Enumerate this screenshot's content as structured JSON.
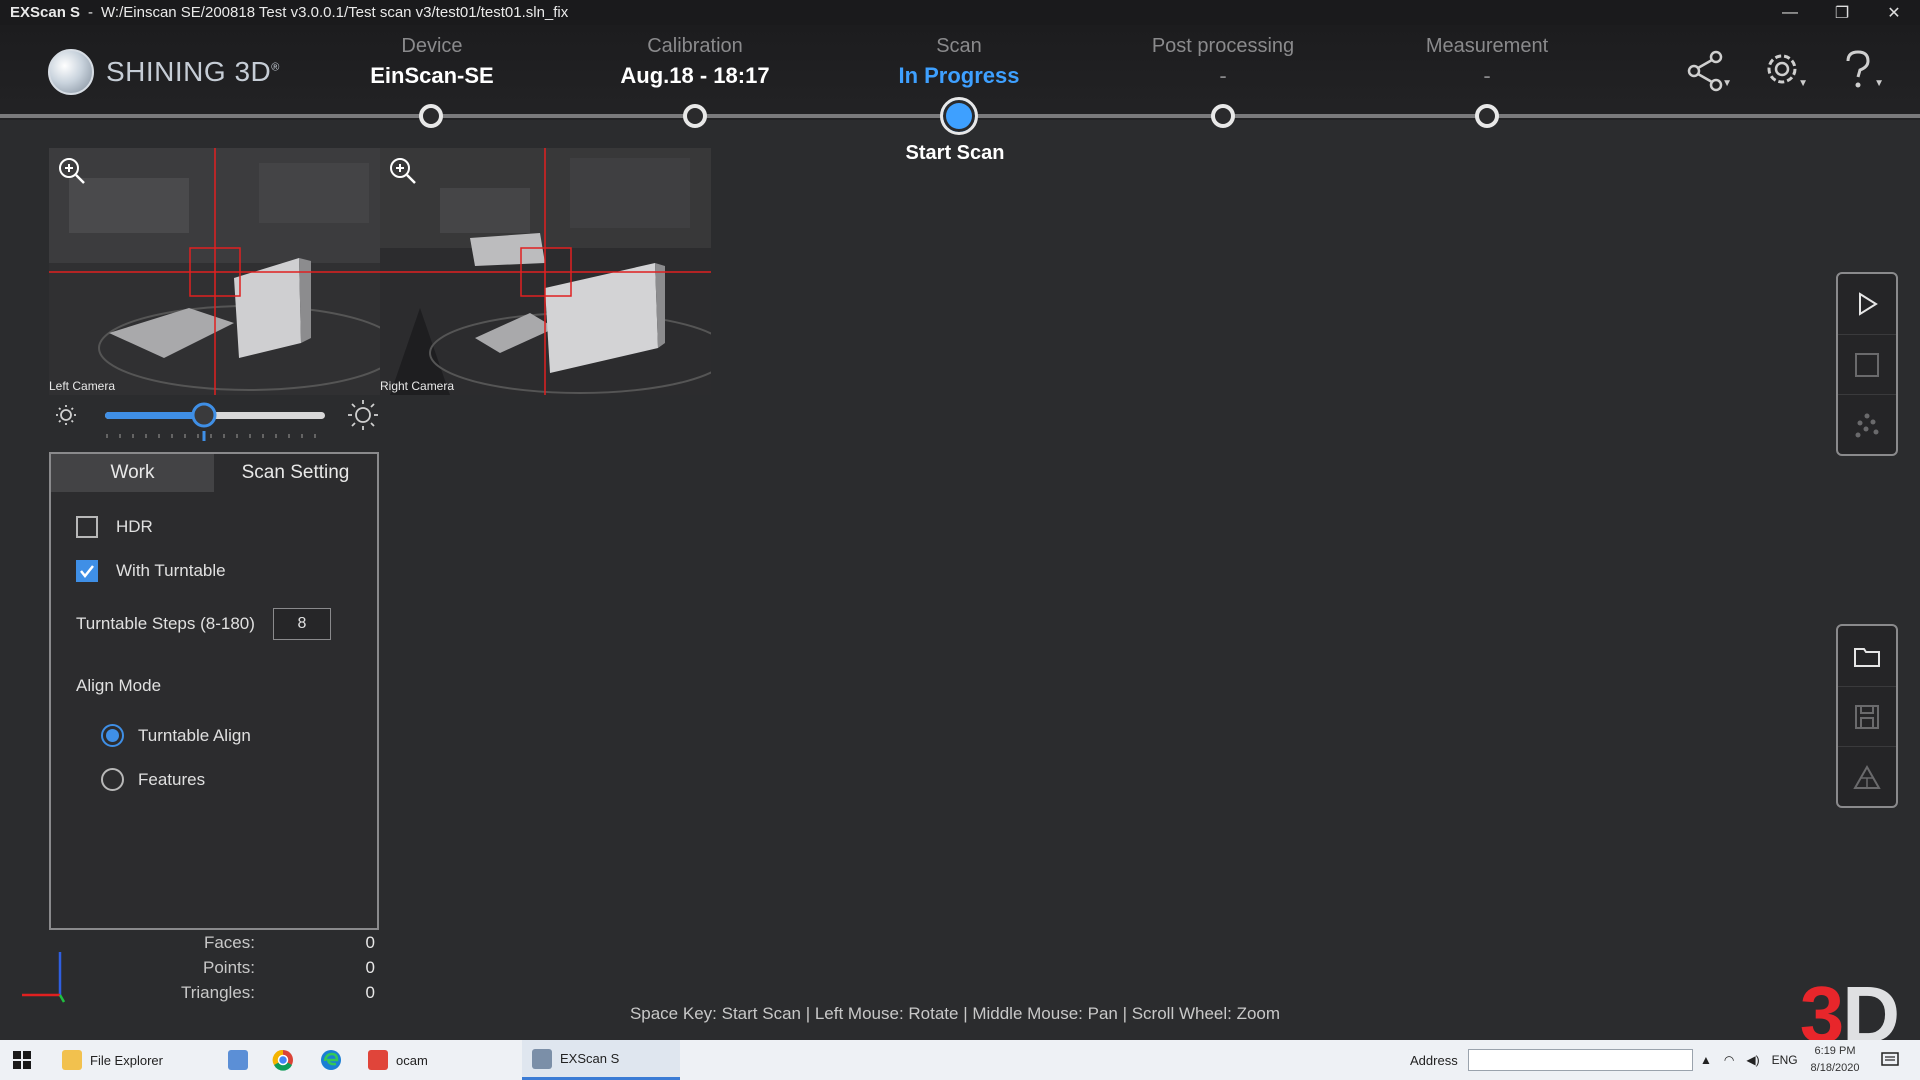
{
  "window": {
    "app_name": "EXScan S",
    "separator": "-",
    "path": "W:/Einscan SE/200818 Test v3.0.0.1/Test scan v3/test01/test01.sln_fix",
    "controls": [
      "—",
      "❐",
      "✕"
    ]
  },
  "brand": {
    "name": "SHINING 3D",
    "reg": "®"
  },
  "steps": [
    {
      "title": "Device",
      "value": "EinScan-SE",
      "state": "done"
    },
    {
      "title": "Calibration",
      "value": "Aug.18 - 18:17",
      "state": "done"
    },
    {
      "title": "Scan",
      "value": "In Progress",
      "state": "current"
    },
    {
      "title": "Post processing",
      "value": "-",
      "state": "pending"
    },
    {
      "title": "Measurement",
      "value": "-",
      "state": "pending"
    }
  ],
  "current_step_action": "Start Scan",
  "header_icons": [
    "share-icon",
    "settings-icon",
    "help-icon"
  ],
  "cameras": {
    "left_label": "Left Camera",
    "right_label": "Right Camera"
  },
  "exposure": {
    "level": 0.45
  },
  "panel": {
    "tabs": [
      {
        "label": "Work",
        "active": false
      },
      {
        "label": "Scan Setting",
        "active": true
      }
    ],
    "hdr": {
      "label": "HDR",
      "checked": false
    },
    "with_turntable": {
      "label": "With Turntable",
      "checked": true
    },
    "turntable_steps": {
      "label": "Turntable Steps (8-180)",
      "value": "8"
    },
    "align_mode": {
      "label": "Align Mode",
      "options": [
        {
          "label": "Turntable Align",
          "selected": true
        },
        {
          "label": "Features",
          "selected": false
        }
      ]
    }
  },
  "stats": [
    {
      "label": "Faces:",
      "value": "0"
    },
    {
      "label": "Points:",
      "value": "0"
    },
    {
      "label": "Triangles:",
      "value": "0"
    }
  ],
  "hint": "Space Key: Start Scan | Left Mouse: Rotate | Middle Mouse: Pan | Scroll Wheel: Zoom",
  "watermark": {
    "three": "3",
    "d": "D"
  },
  "taskbar": {
    "apps": [
      {
        "label": "File Explorer"
      },
      {
        "label": ""
      },
      {
        "label": ""
      },
      {
        "label": ""
      },
      {
        "label": "ocam"
      },
      {
        "label": "EXScan S"
      }
    ],
    "address_label": "Address",
    "tray_lang": "ENG",
    "time": "6:19 PM",
    "date": "8/18/2020"
  },
  "colors": {
    "accent": "#3ea0ff",
    "brand_red": "#e8262b",
    "background": "#2b2c2e"
  }
}
